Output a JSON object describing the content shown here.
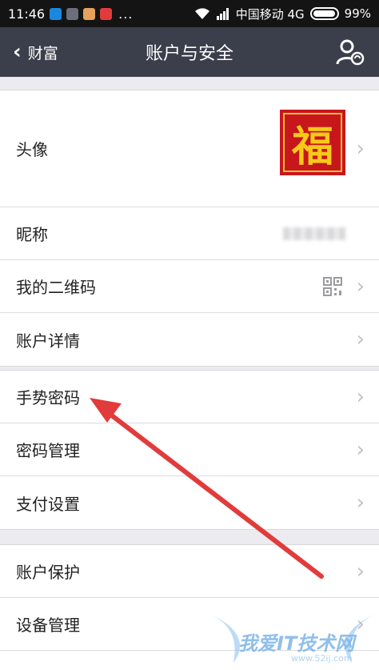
{
  "status_bar": {
    "time": "11:46",
    "dots": "...",
    "carrier": "中国移动 4G",
    "battery": "99%",
    "battery_level": 0.99
  },
  "nav": {
    "back_label": "财富",
    "title": "账户与安全",
    "action_icon": "user-sync-icon"
  },
  "groups": [
    {
      "rows": [
        {
          "label": "头像",
          "avatar_char": "福"
        },
        {
          "label": "昵称"
        },
        {
          "label": "我的二维码"
        },
        {
          "label": "账户详情"
        }
      ]
    },
    {
      "rows": [
        {
          "label": "手势密码"
        },
        {
          "label": "密码管理"
        },
        {
          "label": "支付设置"
        }
      ]
    },
    {
      "rows": [
        {
          "label": "账户保护"
        },
        {
          "label": "设备管理"
        }
      ]
    }
  ],
  "chevron": "›",
  "watermark": {
    "text": "我爱IT技术网",
    "url": "www.52ij.com"
  },
  "colors": {
    "nav_bg": "#3b3f4b",
    "arrow": "#e23b3b",
    "avatar_bg": "#c8161d",
    "avatar_char": "#f7c919"
  }
}
